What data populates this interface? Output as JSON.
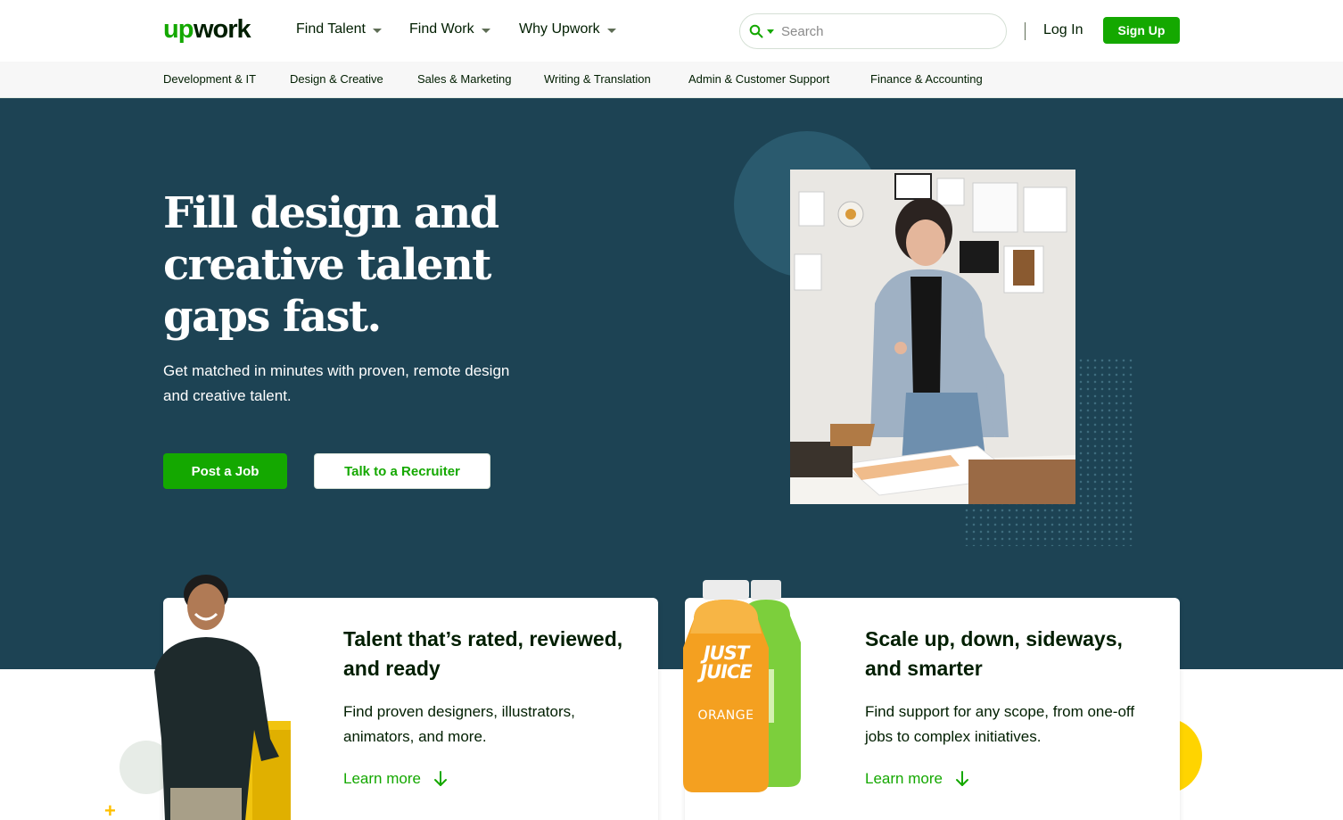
{
  "header": {
    "logo_text": "upwork",
    "nav": [
      {
        "label": "Find Talent"
      },
      {
        "label": "Find Work"
      },
      {
        "label": "Why Upwork"
      }
    ],
    "search": {
      "placeholder": "Search"
    },
    "login_label": "Log In",
    "signup_label": "Sign Up"
  },
  "categories": [
    "Development & IT",
    "Design & Creative",
    "Sales & Marketing",
    "Writing & Translation",
    "Admin & Customer Support",
    "Finance & Accounting"
  ],
  "hero": {
    "title": "Fill design and creative talent gaps fast.",
    "subtitle": "Get matched in minutes with proven, remote design and creative talent.",
    "post_job_label": "Post a Job",
    "talk_recruiter_label": "Talk to a Recruiter"
  },
  "cards": [
    {
      "title": "Talent that’s rated, reviewed, and ready",
      "text": "Find proven designers, illustrators, animators, and more.",
      "link": "Learn more"
    },
    {
      "title": "Scale up, down, sideways, and smarter",
      "text": "Find support for any scope, from one-off jobs to complex initiatives.",
      "link": "Learn more"
    }
  ],
  "juice_bottle": {
    "line1": "JUST",
    "line2": "JUICE",
    "flavor": "ORANGE"
  },
  "colors": {
    "brand_green": "#14a800",
    "hero_bg": "#1d4354",
    "accent_yellow": "#ffd400"
  }
}
